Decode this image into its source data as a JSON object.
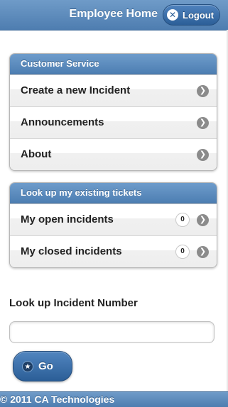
{
  "header": {
    "title": "Employee Home",
    "logout_label": "Logout"
  },
  "customer_service": {
    "heading": "Customer Service",
    "items": [
      {
        "label": "Create a new Incident"
      },
      {
        "label": "Announcements"
      },
      {
        "label": "About"
      }
    ]
  },
  "tickets": {
    "heading": "Look up my existing tickets",
    "items": [
      {
        "label": "My open incidents",
        "count": "0"
      },
      {
        "label": "My closed incidents",
        "count": "0"
      }
    ]
  },
  "lookup": {
    "label": "Look up Incident Number",
    "input_value": "",
    "go_label": "Go"
  },
  "footer": {
    "text": "© 2011 CA Technologies"
  },
  "icons": {
    "logout": "close-icon",
    "go": "star-icon",
    "row_arrow": "chevron-right-icon"
  },
  "colors": {
    "header_blue": "#5a88bb",
    "button_blue": "#2c5f98"
  }
}
